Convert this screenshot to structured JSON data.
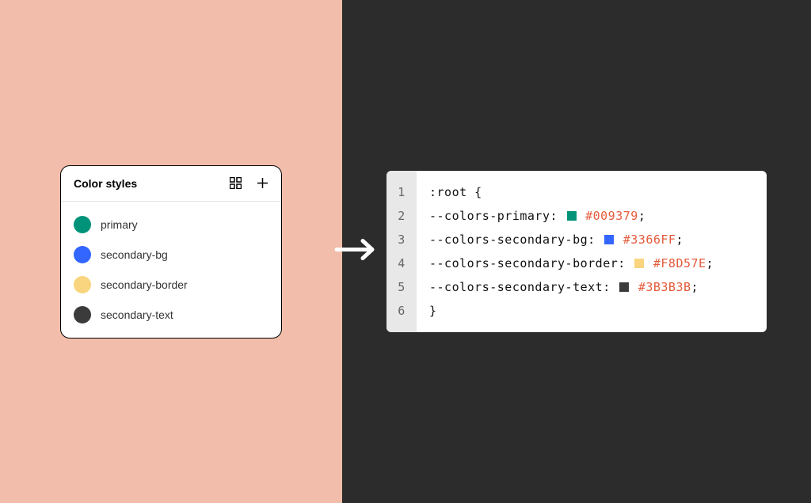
{
  "left_bg": "#F2BDAA",
  "right_bg": "#2C2C2C",
  "styles_panel": {
    "title": "Color styles",
    "items": [
      {
        "name": "primary",
        "color": "#009379"
      },
      {
        "name": "secondary-bg",
        "color": "#3366FF"
      },
      {
        "name": "secondary-border",
        "color": "#F8D57E"
      },
      {
        "name": "secondary-text",
        "color": "#3B3B3B"
      }
    ]
  },
  "code": {
    "line_numbers": [
      "1",
      "2",
      "3",
      "4",
      "5",
      "6"
    ],
    "open": ":root {",
    "close": "}",
    "lines": [
      {
        "prop": "--colors-primary",
        "swatch": "#009379",
        "value": "#009379"
      },
      {
        "prop": "--colors-secondary-bg",
        "swatch": "#3366FF",
        "value": "#3366FF"
      },
      {
        "prop": "--colors-secondary-border",
        "swatch": "#F8D57E",
        "value": "#F8D57E"
      },
      {
        "prop": "--colors-secondary-text",
        "swatch": "#3B3B3B",
        "value": "#3B3B3B"
      }
    ]
  }
}
